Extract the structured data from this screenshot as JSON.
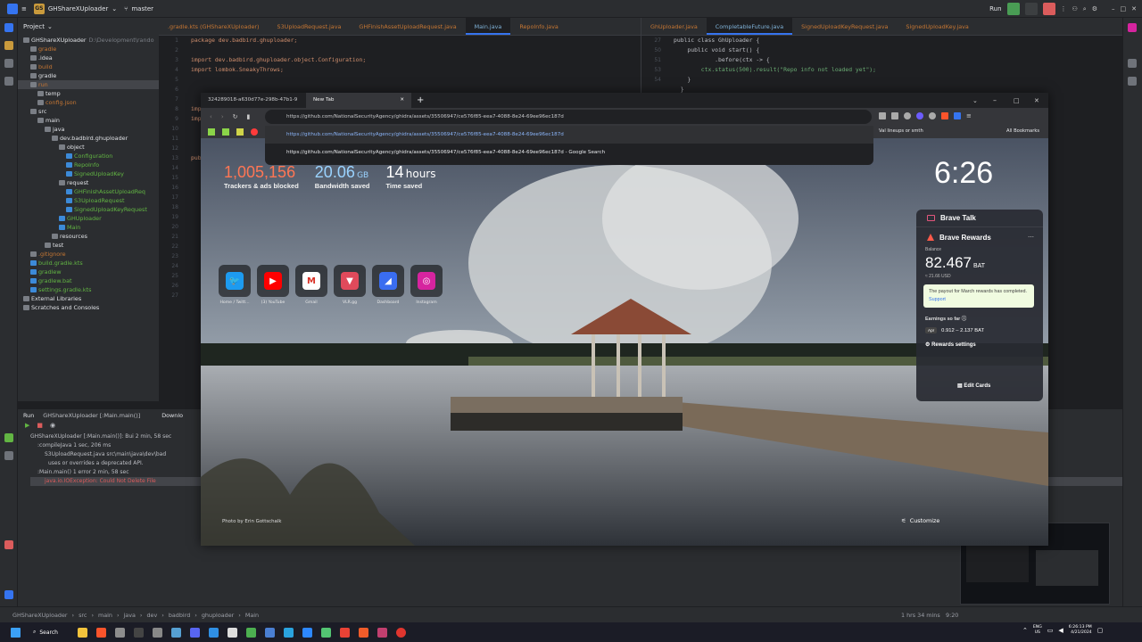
{
  "ide": {
    "project_name": "GHShareXUploader",
    "branch": "master",
    "run_config": "Run",
    "project_panel_title": "Project",
    "tree": [
      {
        "label": "GHShareXUploader",
        "path": "D:\\Development\\rando",
        "color": "#dfe1e5"
      },
      {
        "label": "gradle",
        "color": "#c57633"
      },
      {
        "label": ".idea",
        "color": "#dfe1e5"
      },
      {
        "label": "build",
        "color": "#c57633"
      },
      {
        "label": "gradle",
        "color": "#dfe1e5"
      },
      {
        "label": "run",
        "color": "#c57633"
      },
      {
        "label": "temp",
        "color": "#dfe1e5"
      },
      {
        "label": "config.json",
        "color": "#c57633"
      },
      {
        "label": "src",
        "color": "#dfe1e5"
      },
      {
        "label": "main",
        "color": "#dfe1e5"
      },
      {
        "label": "java",
        "color": "#dfe1e5"
      },
      {
        "label": "dev.badbird.ghuploader",
        "color": "#dfe1e5"
      },
      {
        "label": "object",
        "color": "#dfe1e5"
      },
      {
        "label": "Configuration",
        "color": "#62b543"
      },
      {
        "label": "RepoInfo",
        "color": "#62b543"
      },
      {
        "label": "SignedUploadKey",
        "color": "#62b543"
      },
      {
        "label": "request",
        "color": "#dfe1e5"
      },
      {
        "label": "GHFinishAssetUploadReq",
        "color": "#62b543"
      },
      {
        "label": "S3UploadRequest",
        "color": "#62b543"
      },
      {
        "label": "SignedUploadKeyRequest",
        "color": "#62b543"
      },
      {
        "label": "GHUploader",
        "color": "#62b543"
      },
      {
        "label": "Main",
        "color": "#62b543"
      },
      {
        "label": "resources",
        "color": "#dfe1e5"
      },
      {
        "label": "test",
        "color": "#dfe1e5"
      },
      {
        "label": ".gitignore",
        "color": "#c57633"
      },
      {
        "label": "build.gradle.kts",
        "color": "#62b543"
      },
      {
        "label": "gradlew",
        "color": "#62b543"
      },
      {
        "label": "gradlew.bat",
        "color": "#62b543"
      },
      {
        "label": "settings.gradle.kts",
        "color": "#62b543"
      },
      {
        "label": "External Libraries",
        "color": "#dfe1e5"
      },
      {
        "label": "Scratches and Consoles",
        "color": "#dfe1e5"
      }
    ],
    "tabs_left": [
      ".gradle.kts (GHShareXUploader)",
      "S3UploadRequest.java",
      "GHFinishAssetUploadRequest.java",
      "Main.java",
      "RepoInfo.java"
    ],
    "tabs_right": [
      "GhUploader.java",
      "CompletableFuture.java",
      "SignedUploadKeyRequest.java",
      "SignedUploadKey.java"
    ],
    "code_left": [
      "package dev.badbird.ghuploader;",
      "",
      "import dev.badbird.ghuploader.object.Configuration;",
      "import lombok.SneakyThrows;",
      "",
      "import java.io.File;",
      "imp",
      "",
      "pub"
    ],
    "code_right": [
      "public class GhUploader {",
      "    public void start() {",
      "            .before(ctx -> {",
      "        ctx.status(500).result(\"Repo info not loaded yet\");",
      "    }",
      "  }"
    ],
    "right_numbers": [
      "27",
      "50",
      "51",
      "53",
      "54"
    ],
    "run_tab": "Run",
    "run_config_tab": "GHShareXUploader [:Main.main()]",
    "download_tab": "Downlo",
    "run_tree": [
      "GHShareXUploader [:Main.main()]: Bui  2 min, 58 sec",
      ":compileJava  1 sec, 206 ms",
      "S3UploadRequest.java  src\\main\\java\\dev\\bad",
      "uses or overrides a deprecated API.",
      ":Main.main()  1 error  2 min, 58 sec",
      "java.io.IOException: Could Not Delete File"
    ],
    "breadcrumbs": [
      "GHShareXUploader",
      "src",
      "main",
      "java",
      "dev",
      "badbird",
      "ghuploader",
      "Main"
    ],
    "status_right": "1 hrs 34 mins",
    "status_pos": "9:20"
  },
  "browser": {
    "tab_inactive": "324289018-a630d77e-298b-47b1-9",
    "tab_active": "New Tab",
    "url_text": "https://github.com/NationalSecurityAgency/ghidra/assets/35506947/ce576f85-eea7-4088-8e24-69ee96ec187d",
    "suggestions": [
      "https://github.com/NationalSecurityAgency/ghidra/assets/35506947/ce576f85-eea7-4088-8e24-69ee96ec187d",
      "https://github.com/NationalSecurityAgency/ghidra/assets/35506947/ce576f85-eea7-4088-8e24-69ee96ec187d - Google Search"
    ],
    "bookmark_folder": "Val lineups or smth",
    "all_bookmarks": "All Bookmarks",
    "stats": [
      {
        "value": "1,005,156",
        "label": "Trackers & ads blocked",
        "color": "#ff7654"
      },
      {
        "value": "20.06",
        "unit": "GB",
        "label": "Bandwidth saved",
        "color": "#9ad3ff"
      },
      {
        "value": "14",
        "unit": "hours",
        "label": "Time saved",
        "color": "#ffffff"
      }
    ],
    "clock": "6:26",
    "tiles": [
      {
        "label": "Home / Twitt...",
        "icon": "twitter-icon",
        "bg": "#1d9bf0"
      },
      {
        "label": "(3) YouTube",
        "icon": "youtube-icon",
        "bg": "#ff0000"
      },
      {
        "label": "Gmail",
        "icon": "gmail-icon",
        "bg": "#ffffff"
      },
      {
        "label": "VLR.gg",
        "icon": "vlr-icon",
        "bg": "#e04a5b"
      },
      {
        "label": "Dashboard",
        "icon": "dashboard-icon",
        "bg": "#3a6df0"
      },
      {
        "label": "Instagram",
        "icon": "instagram-icon",
        "bg": "#d6249f"
      }
    ],
    "brave_talk": "Brave Talk",
    "brave_rewards": "Brave Rewards",
    "balance_label": "Balance",
    "balance_value": "82.467",
    "balance_unit": "BAT",
    "balance_usd": "≈ 21.66 USD",
    "payout_notice": "The payout for March rewards has completed.",
    "payout_link": "Support",
    "earnings_label": "Earnings so far",
    "earnings_month": "Apr",
    "earnings_range": "0.912 – 2.137 BAT",
    "rewards_settings": "Rewards settings",
    "edit_cards": "Edit Cards",
    "photo_credit": "Photo by Erin Gottschalk",
    "customize": "Customize"
  },
  "taskbar": {
    "search": "Search",
    "lang": "ENG",
    "region": "US",
    "time": "6:26:13 PM",
    "date": "4/21/2024"
  }
}
